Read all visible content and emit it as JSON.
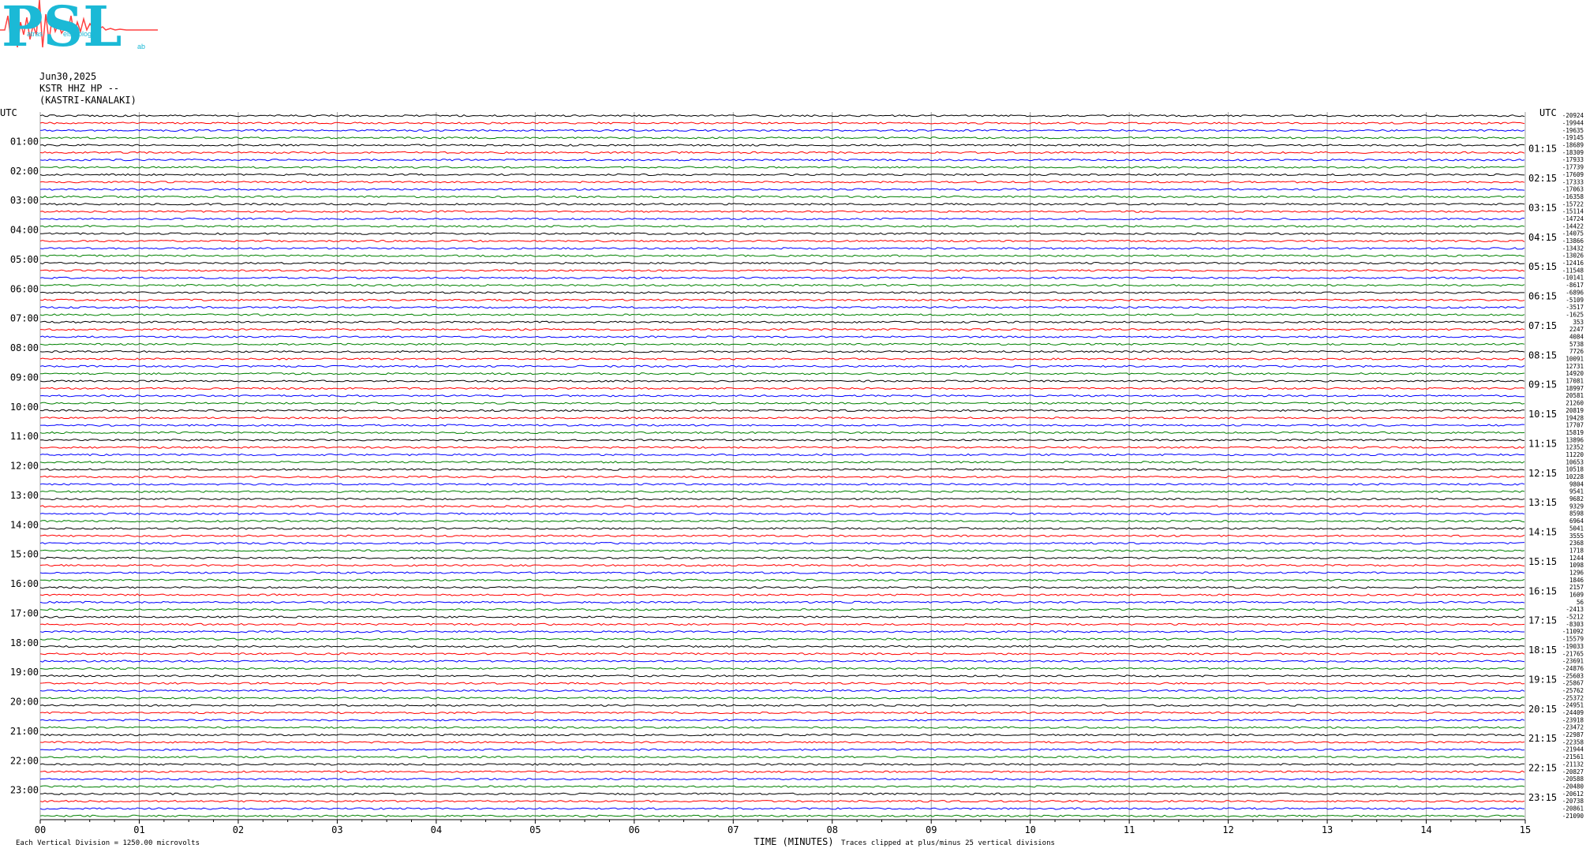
{
  "header": {
    "date": "Jun30,2025",
    "station": "KSTR HHZ HP --",
    "location": "(KASTRI-KANALAKI)"
  },
  "logo": {
    "text": "PSL",
    "caption_a": "atras",
    "caption_b": "eismology",
    "caption_c": "ab"
  },
  "footer": {
    "scale_note": "Each Vertical Division = 1250.00 microvolts",
    "clip_note": "Traces clipped at plus/minus 25 vertical divisions"
  },
  "colors": {
    "trace_cycle": [
      "#000000",
      "#ff0000",
      "#0000ff",
      "#008000"
    ],
    "grid": "#a0a0a0",
    "logo_cyan": "#1bb9d6",
    "logo_red": "#ff4040"
  },
  "chart_data": {
    "type": "line",
    "title": "",
    "xlabel": "TIME (MINUTES)",
    "xlim": [
      0,
      15
    ],
    "x_ticks": [
      "00",
      "01",
      "02",
      "03",
      "04",
      "05",
      "06",
      "07",
      "08",
      "09",
      "10",
      "11",
      "12",
      "13",
      "14",
      "15"
    ],
    "left_axis_title": "UTC",
    "right_axis_title": "UTC",
    "left_hour_labels": [
      "01:00",
      "02:00",
      "03:00",
      "04:00",
      "05:00",
      "06:00",
      "07:00",
      "08:00",
      "09:00",
      "10:00",
      "11:00",
      "12:00",
      "13:00",
      "14:00",
      "15:00",
      "16:00",
      "17:00",
      "18:00",
      "19:00",
      "20:00",
      "21:00",
      "22:00",
      "23:00"
    ],
    "right_hour_labels": [
      "01:15",
      "02:15",
      "03:15",
      "04:15",
      "05:15",
      "06:15",
      "07:15",
      "08:15",
      "09:15",
      "10:15",
      "11:15",
      "12:15",
      "13:15",
      "14:15",
      "15:15",
      "16:15",
      "17:15",
      "18:15",
      "19:15",
      "20:15",
      "21:15",
      "22:15",
      "23:15"
    ],
    "trace_minutes": 15,
    "trace_offsets": [
      -20924,
      -19944,
      -19635,
      -19145,
      -18689,
      -18309,
      -17933,
      -17739,
      -17609,
      -17333,
      -17063,
      -16358,
      -15722,
      -15114,
      -14724,
      -14422,
      -14075,
      -13866,
      -13432,
      -13026,
      -12416,
      -11548,
      -10141,
      -8617,
      -6896,
      -5109,
      -3517,
      -1625,
      353,
      2247,
      4084,
      5738,
      7726,
      10091,
      12731,
      14920,
      17081,
      18997,
      20581,
      21260,
      20819,
      19428,
      17707,
      15819,
      13896,
      12352,
      11220,
      10653,
      10518,
      10228,
      9804,
      9541,
      9682,
      9329,
      8598,
      6964,
      5041,
      3555,
      2368,
      1718,
      1244,
      1098,
      1296,
      1846,
      2157,
      1609,
      56,
      -2413,
      -5212,
      -8303,
      -11092,
      -15579,
      -19033,
      -21765,
      -23691,
      -24876,
      -25603,
      -25867,
      -25762,
      -25372,
      -24951,
      -24409,
      -23918,
      -23472,
      -22987,
      -22358,
      -21944,
      -21561,
      -21132,
      -20827,
      -20588,
      -20480,
      -20612,
      -20738,
      -20861,
      -21090
    ]
  }
}
